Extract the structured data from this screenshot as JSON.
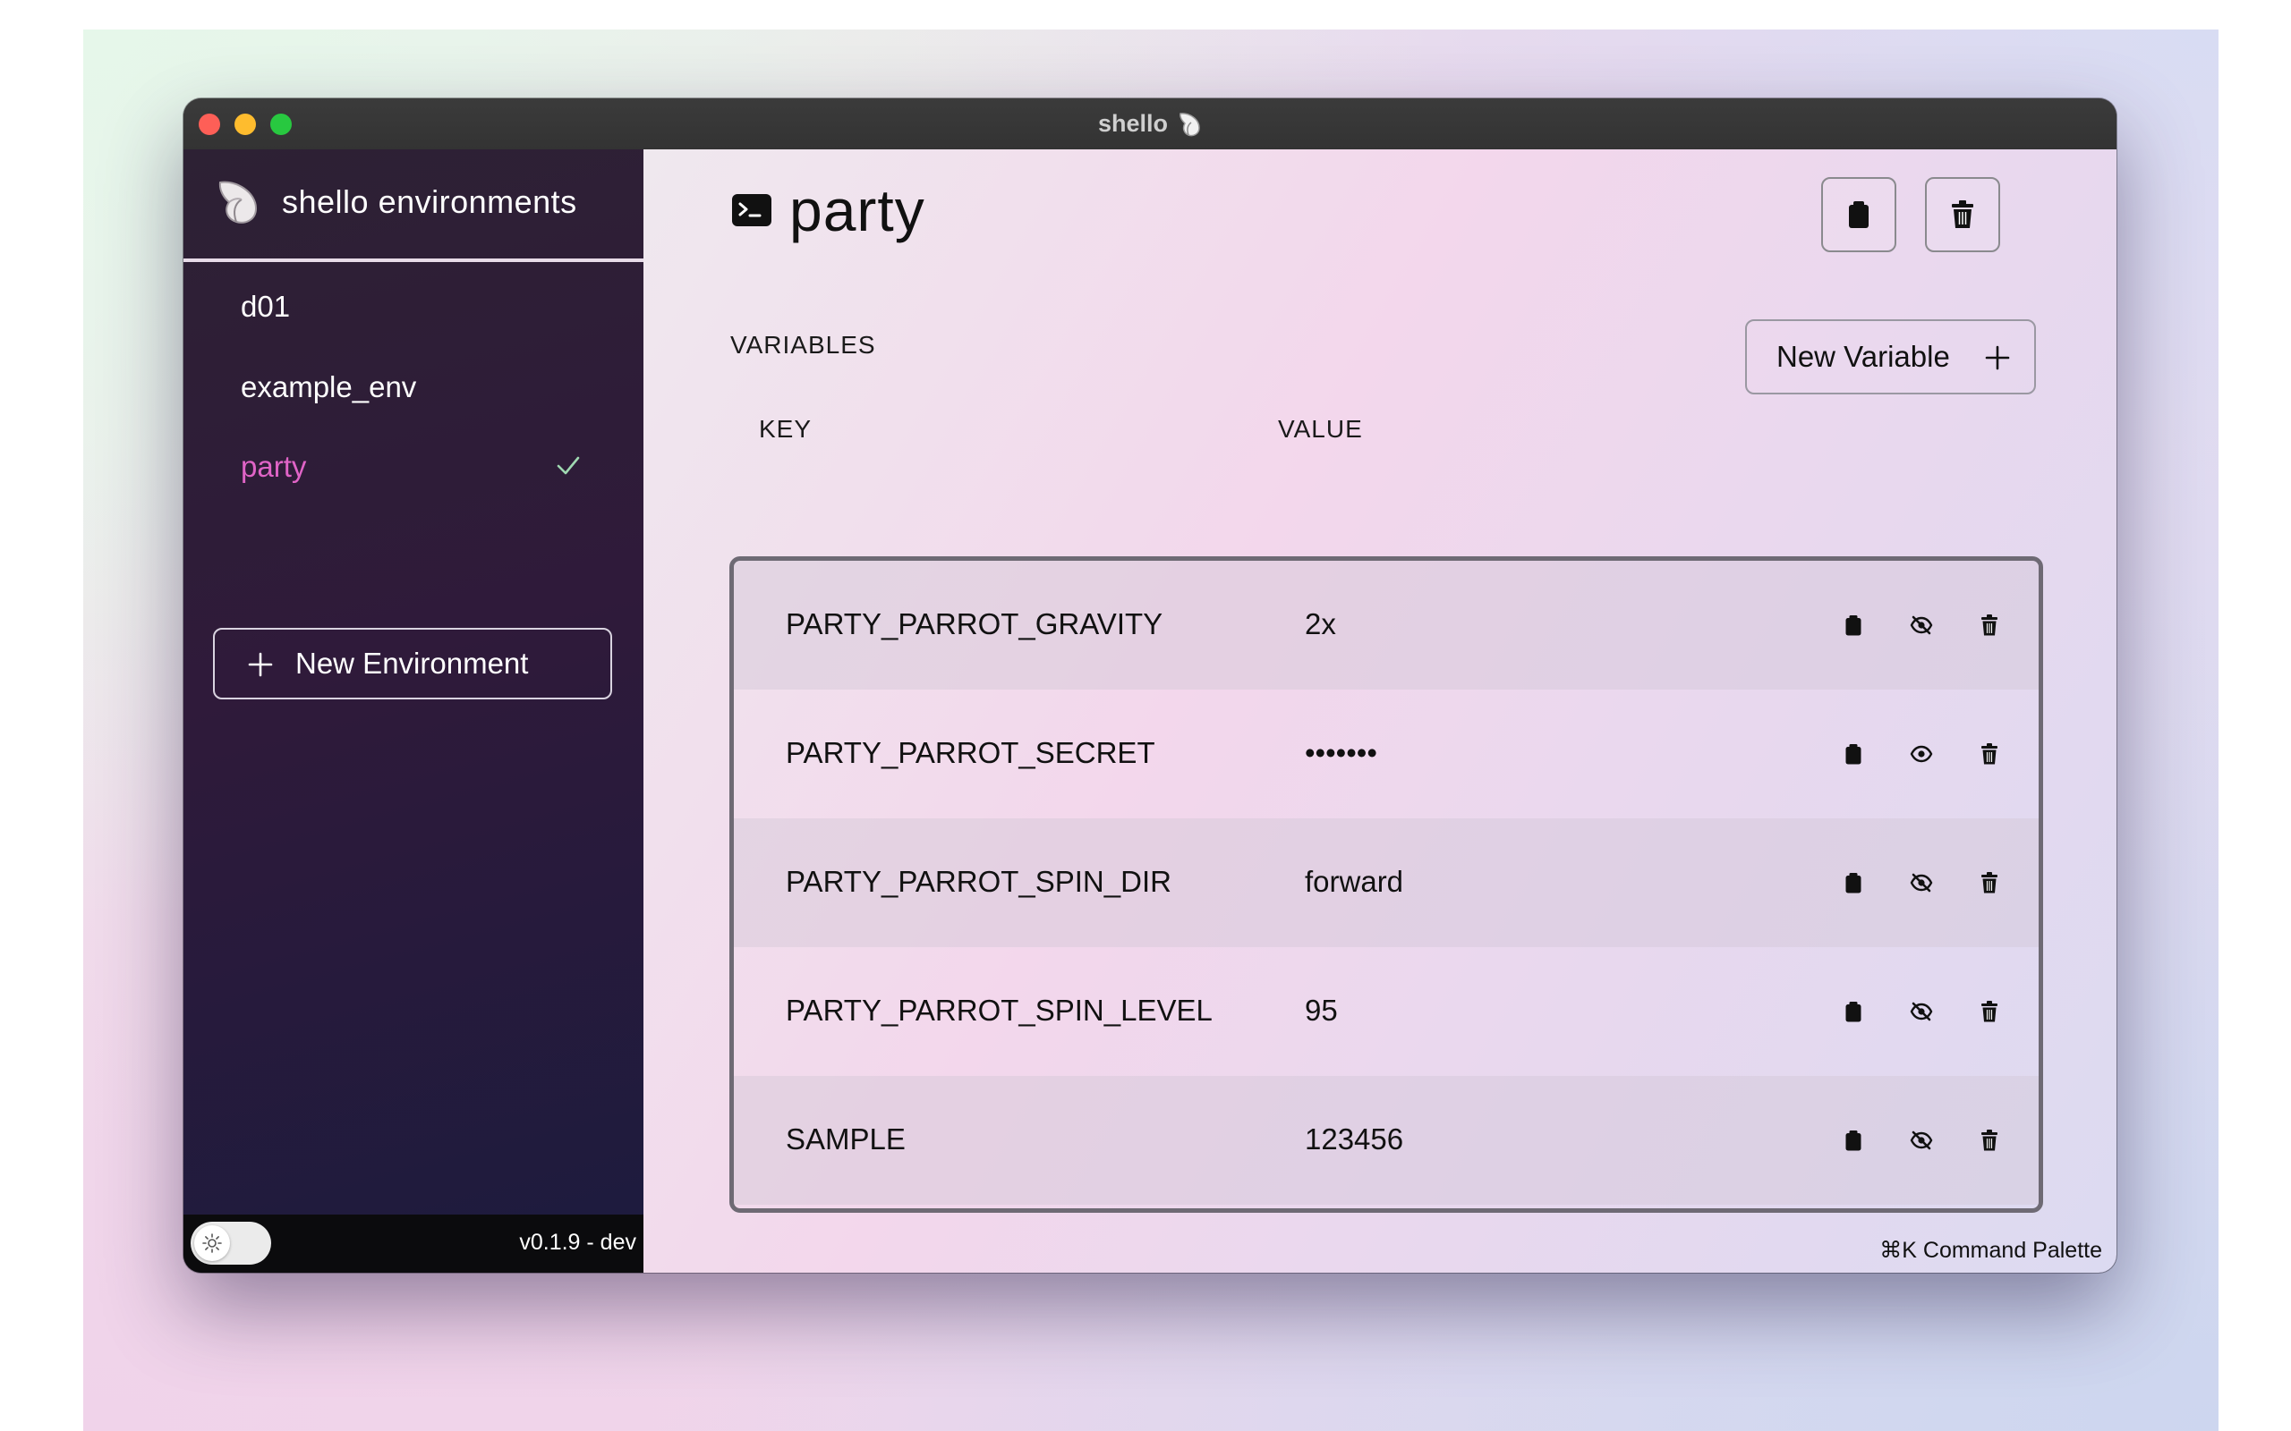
{
  "window": {
    "title": "shello"
  },
  "sidebar": {
    "title": "shello environments",
    "environments": [
      {
        "name": "d01",
        "active": false
      },
      {
        "name": "example_env",
        "active": false
      },
      {
        "name": "party",
        "active": true
      }
    ],
    "new_environment_label": "New Environment",
    "version": "v0.1.9 - dev",
    "accent_color": "#e064c7"
  },
  "main": {
    "title": "party",
    "section_label": "VARIABLES",
    "new_variable_label": "New Variable",
    "columns": {
      "key": "KEY",
      "value": "VALUE"
    },
    "variables": [
      {
        "key": "PARTY_PARROT_GRAVITY",
        "value": "2x",
        "hidden": false
      },
      {
        "key": "PARTY_PARROT_SECRET",
        "value": "•••••••",
        "hidden": true
      },
      {
        "key": "PARTY_PARROT_SPIN_DIR",
        "value": "forward",
        "hidden": false
      },
      {
        "key": "PARTY_PARROT_SPIN_LEVEL",
        "value": "95",
        "hidden": false
      },
      {
        "key": "SAMPLE",
        "value": "123456",
        "hidden": false
      }
    ],
    "command_palette_hint": "⌘K Command Palette"
  }
}
